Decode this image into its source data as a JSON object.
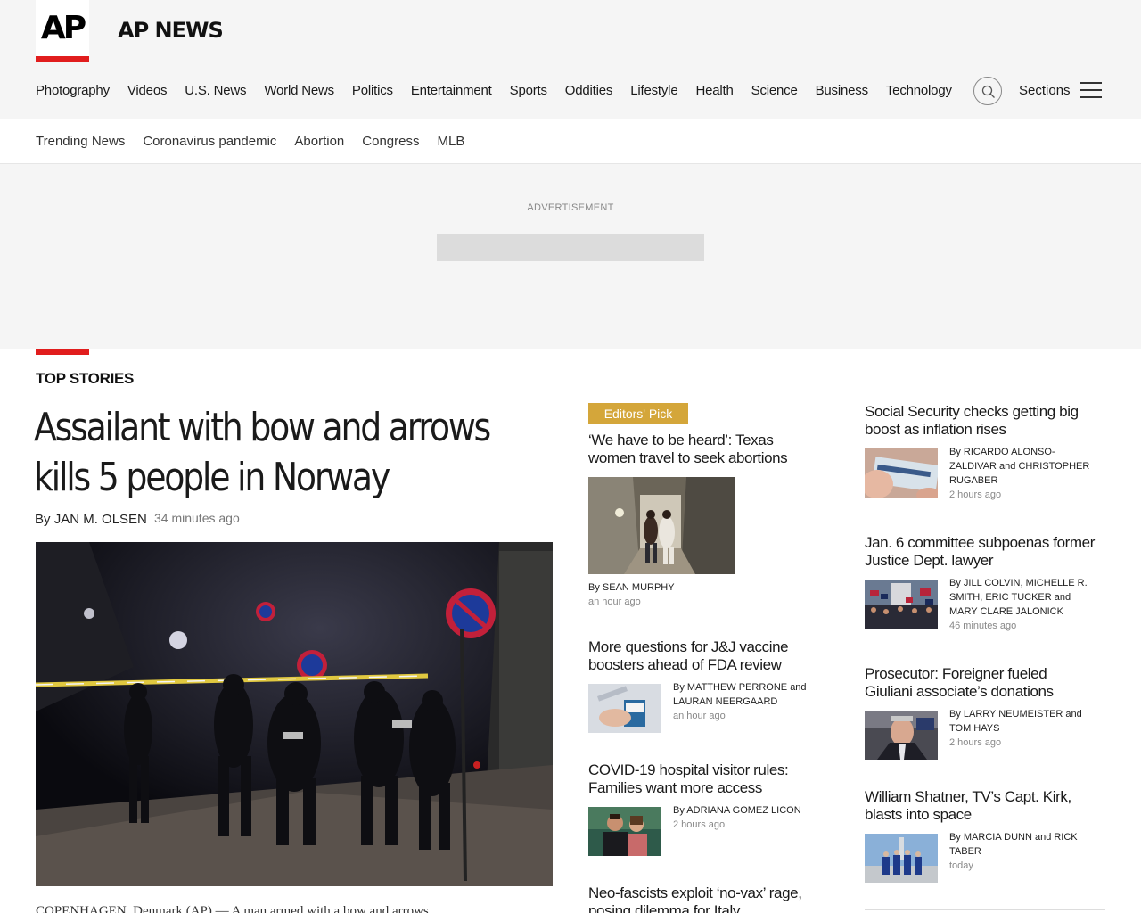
{
  "header": {
    "logo": "AP",
    "brand": "AP NEWS",
    "nav": [
      "Photography",
      "Videos",
      "U.S. News",
      "World News",
      "Politics",
      "Entertainment",
      "Sports",
      "Oddities",
      "Lifestyle",
      "Health",
      "Science",
      "Business",
      "Technology"
    ],
    "sections_label": "Sections",
    "icons": {
      "search": "search-icon",
      "menu": "hamburger-icon"
    },
    "accent_color": "#e11d1d"
  },
  "trending": [
    "Trending News",
    "Coronavirus pandemic",
    "Abortion",
    "Congress",
    "MLB"
  ],
  "ad": {
    "label": "ADVERTISEMENT"
  },
  "top_stories": {
    "title": "TOP STORIES",
    "main": {
      "headline": "Assailant with bow and arrows kills 5 people in Norway",
      "byline_prefix": "By",
      "author": "JAN M. OLSEN",
      "time": "34 minutes ago",
      "caption": "COPENHAGEN, Denmark (AP) — A man armed with a bow and arrows"
    },
    "editors_pick": {
      "badge": "Editors' Pick",
      "badge_color": "#d4a63a",
      "title": "‘We have to be heard’: Texas women travel to seek abortions",
      "byline": "By SEAN MURPHY",
      "time": "an hour ago"
    },
    "middle": [
      {
        "title": "More questions for J&J vaccine boosters ahead of FDA review",
        "byline": "By MATTHEW PERRONE and LAURAN NEERGAARD",
        "time": "an hour ago"
      },
      {
        "title": "COVID-19 hospital visitor rules: Families want more access",
        "byline": "By ADRIANA GOMEZ LICON",
        "time": "2 hours ago"
      },
      {
        "title": "Neo-fascists exploit ‘no-vax’ rage, posing dilemma for Italy",
        "byline": "",
        "time": ""
      }
    ],
    "right": [
      {
        "title": "Social Security checks getting big boost as inflation rises",
        "byline": "By RICARDO ALONSO-ZALDIVAR and CHRISTOPHER RUGABER",
        "time": "2 hours ago"
      },
      {
        "title": "Jan. 6 committee subpoenas former Justice Dept. lawyer",
        "byline": "By JILL COLVIN, MICHELLE R. SMITH, ERIC TUCKER and MARY CLARE JALONICK",
        "time": "46 minutes ago"
      },
      {
        "title": "Prosecutor: Foreigner fueled Giuliani associate’s donations",
        "byline": "By LARRY NEUMEISTER and TOM HAYS",
        "time": "2 hours ago"
      },
      {
        "title": "William Shatner, TV’s Capt. Kirk, blasts into space",
        "byline": "By MARCIA DUNN and RICK TABER",
        "time": "today"
      }
    ]
  }
}
